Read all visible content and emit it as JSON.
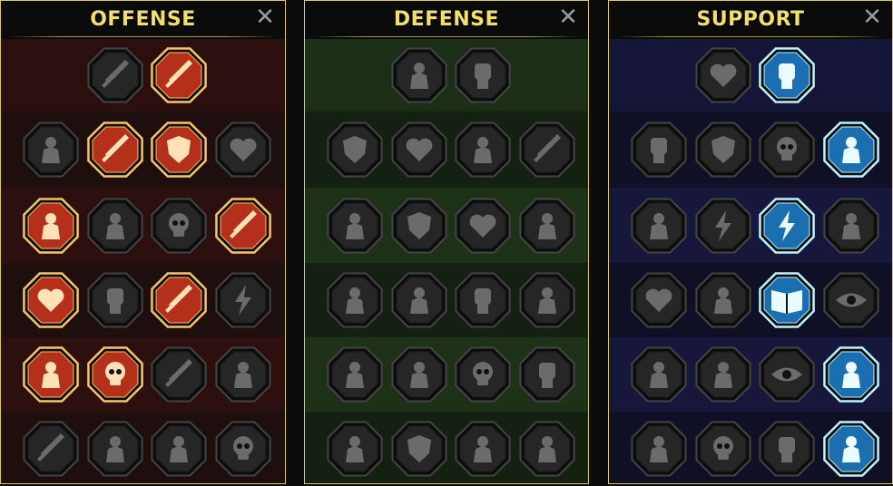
{
  "colors": {
    "header_text": "#f2e06a",
    "border": "#d9c85f",
    "close_icon": "#9a9a9a",
    "inactive_fill": "#262626",
    "inactive_rim": "#444444",
    "inactive_glyph": "#6b6b6b",
    "offense_active_fill": "#b5301a",
    "offense_active_rim": "#f7c46a",
    "offense_active_glyph": "#ffe2b8",
    "support_active_fill": "#1b6fb0",
    "support_active_rim": "#bdf2ff",
    "support_active_glyph": "#eafcff"
  },
  "panels": [
    {
      "id": "offense",
      "title": "OFFENSE",
      "close_glyph": "✕",
      "rows": [
        [
          {
            "icon": "crossed-swords-icon",
            "active": false
          },
          {
            "icon": "dagger-strike-icon",
            "active": true
          }
        ],
        [
          {
            "icon": "horned-warrior-icon",
            "active": false
          },
          {
            "icon": "falling-blades-icon",
            "active": true
          },
          {
            "icon": "shield-break-icon",
            "active": true
          },
          {
            "icon": "cursed-heart-icon",
            "active": false
          }
        ],
        [
          {
            "icon": "pierced-body-icon",
            "active": true
          },
          {
            "icon": "monster-maw-icon",
            "active": false
          },
          {
            "icon": "skull-cloak-icon",
            "active": false
          },
          {
            "icon": "sickle-slash-icon",
            "active": true
          }
        ],
        [
          {
            "icon": "bleeding-heart-sword-icon",
            "active": true
          },
          {
            "icon": "fist-hammer-icon",
            "active": false
          },
          {
            "icon": "axe-strike-icon",
            "active": true
          },
          {
            "icon": "chain-lightning-icon",
            "active": false
          }
        ],
        [
          {
            "icon": "triple-arrow-target-icon",
            "active": true
          },
          {
            "icon": "twin-skulls-icon",
            "active": true
          },
          {
            "icon": "needle-sigil-icon",
            "active": false
          },
          {
            "icon": "electrified-man-icon",
            "active": false
          }
        ],
        [
          {
            "icon": "spear-thrust-icon",
            "active": false
          },
          {
            "icon": "knight-helm-icon",
            "active": false
          },
          {
            "icon": "demon-beast-icon",
            "active": false
          },
          {
            "icon": "spiked-skull-icon",
            "active": false
          }
        ]
      ]
    },
    {
      "id": "defense",
      "title": "DEFENSE",
      "close_glyph": "✕",
      "rows": [
        [
          {
            "icon": "armor-plates-icon",
            "active": false
          },
          {
            "icon": "raised-fist-icon",
            "active": false
          }
        ],
        [
          {
            "icon": "chevron-shield-icon",
            "active": false
          },
          {
            "icon": "anatomical-heart-icon",
            "active": false
          },
          {
            "icon": "armored-statue-icon",
            "active": false
          },
          {
            "icon": "blade-deflect-icon",
            "active": false
          }
        ],
        [
          {
            "icon": "dodge-silhouette-icon",
            "active": false
          },
          {
            "icon": "knight-with-shield-icon",
            "active": false
          },
          {
            "icon": "heart-ward-icon",
            "active": false
          },
          {
            "icon": "hooded-guardian-icon",
            "active": false
          }
        ],
        [
          {
            "icon": "crowd-rise-icon",
            "active": false
          },
          {
            "icon": "hourglass-burst-icon",
            "active": false
          },
          {
            "icon": "open-palm-icon",
            "active": false
          },
          {
            "icon": "bull-head-icon",
            "active": false
          }
        ],
        [
          {
            "icon": "sprinting-man-icon",
            "active": false
          },
          {
            "icon": "falling-drops-icon",
            "active": false
          },
          {
            "icon": "skull-aura-icon",
            "active": false
          },
          {
            "icon": "claw-slash-icon",
            "active": false
          }
        ],
        [
          {
            "icon": "flaming-demon-icon",
            "active": false
          },
          {
            "icon": "winged-shield-icon",
            "active": false
          },
          {
            "icon": "bearded-warrior-icon",
            "active": false
          },
          {
            "icon": "muscle-flex-icon",
            "active": false
          }
        ]
      ]
    },
    {
      "id": "support",
      "title": "SUPPORT",
      "close_glyph": "✕",
      "rows": [
        [
          {
            "icon": "heart-sparkles-icon",
            "active": false
          },
          {
            "icon": "striking-hand-icon",
            "active": true
          }
        ],
        [
          {
            "icon": "praying-hands-icon",
            "active": false
          },
          {
            "icon": "nested-shield-icon",
            "active": false
          },
          {
            "icon": "flaming-skull-icon",
            "active": false
          },
          {
            "icon": "rapid-speed-icon",
            "active": true
          }
        ],
        [
          {
            "icon": "blessed-figure-icon",
            "active": false
          },
          {
            "icon": "lightning-bolt-icon",
            "active": false
          },
          {
            "icon": "zigzag-bolts-icon",
            "active": true
          },
          {
            "icon": "shadow-double-icon",
            "active": false
          }
        ],
        [
          {
            "icon": "chained-heart-icon",
            "active": false
          },
          {
            "icon": "comet-icon",
            "active": false
          },
          {
            "icon": "open-book-icon",
            "active": true
          },
          {
            "icon": "glaring-eyes-icon",
            "active": false
          }
        ],
        [
          {
            "icon": "compass-star-icon",
            "active": false
          },
          {
            "icon": "winged-boot-icon",
            "active": false
          },
          {
            "icon": "all-seeing-eye-icon",
            "active": false
          },
          {
            "icon": "flying-kick-icon",
            "active": true
          }
        ],
        [
          {
            "icon": "potion-flask-icon",
            "active": false
          },
          {
            "icon": "skull-crossbones-icon",
            "active": false
          },
          {
            "icon": "gripping-claw-icon",
            "active": false
          },
          {
            "icon": "eagle-head-icon",
            "active": true
          }
        ]
      ]
    }
  ]
}
